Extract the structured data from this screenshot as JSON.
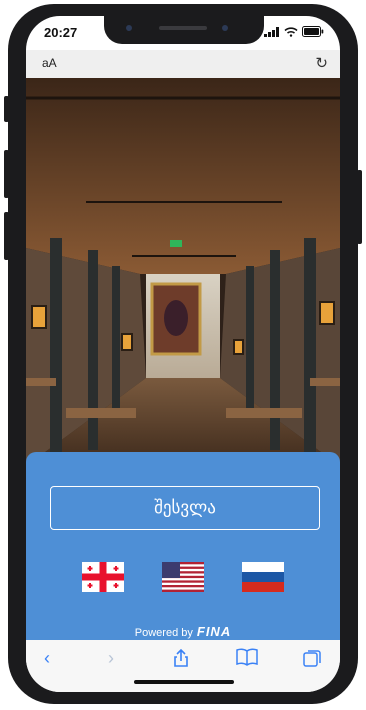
{
  "status_bar": {
    "time": "20:27"
  },
  "browser": {
    "text_size_label": "aA",
    "reload_icon": "reload-icon"
  },
  "hero": {
    "image": "restaurant-interior-photo"
  },
  "panel": {
    "login_label": "შესვლა",
    "languages": [
      {
        "name": "georgian-flag-icon",
        "code": "ka"
      },
      {
        "name": "us-flag-icon",
        "code": "en"
      },
      {
        "name": "russian-flag-icon",
        "code": "ru"
      }
    ],
    "powered_by": "Powered by",
    "brand": "FINA",
    "color": "#4e8fd6"
  },
  "toolbar": {
    "icons": [
      "back-icon",
      "forward-icon",
      "share-icon",
      "bookmarks-icon",
      "tabs-icon"
    ]
  }
}
